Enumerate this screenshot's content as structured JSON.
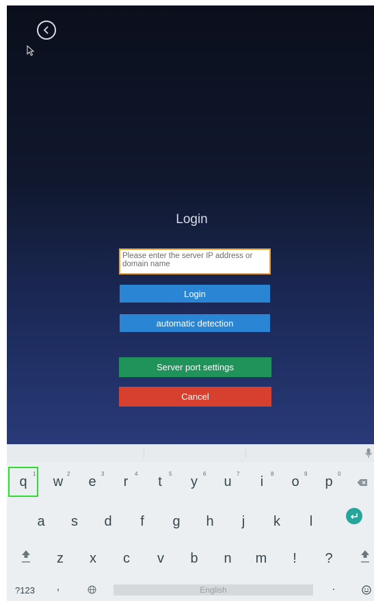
{
  "app": {
    "title": "Login",
    "ip_placeholder": "Please enter the server IP address or domain name",
    "login_label": "Login",
    "auto_detect_label": "automatic detection",
    "port_settings_label": "Server port settings",
    "cancel_label": "Cancel"
  },
  "keyboard": {
    "row1": [
      "q",
      "w",
      "e",
      "r",
      "t",
      "y",
      "u",
      "i",
      "o",
      "p"
    ],
    "row1_hints": [
      "1",
      "2",
      "3",
      "4",
      "5",
      "6",
      "7",
      "8",
      "9",
      "0"
    ],
    "row2": [
      "a",
      "s",
      "d",
      "f",
      "g",
      "h",
      "j",
      "k",
      "l"
    ],
    "row3": [
      "z",
      "x",
      "c",
      "v",
      "b",
      "n",
      "m",
      "!",
      "?"
    ],
    "symbols_label": "?123",
    "comma": ",",
    "space_label": "English",
    "period": "."
  },
  "colors": {
    "accent_blue": "#2a86d4",
    "green": "#20935b",
    "red": "#d7402e",
    "input_border": "#f0a22e",
    "highlight": "#2cdc2c"
  }
}
